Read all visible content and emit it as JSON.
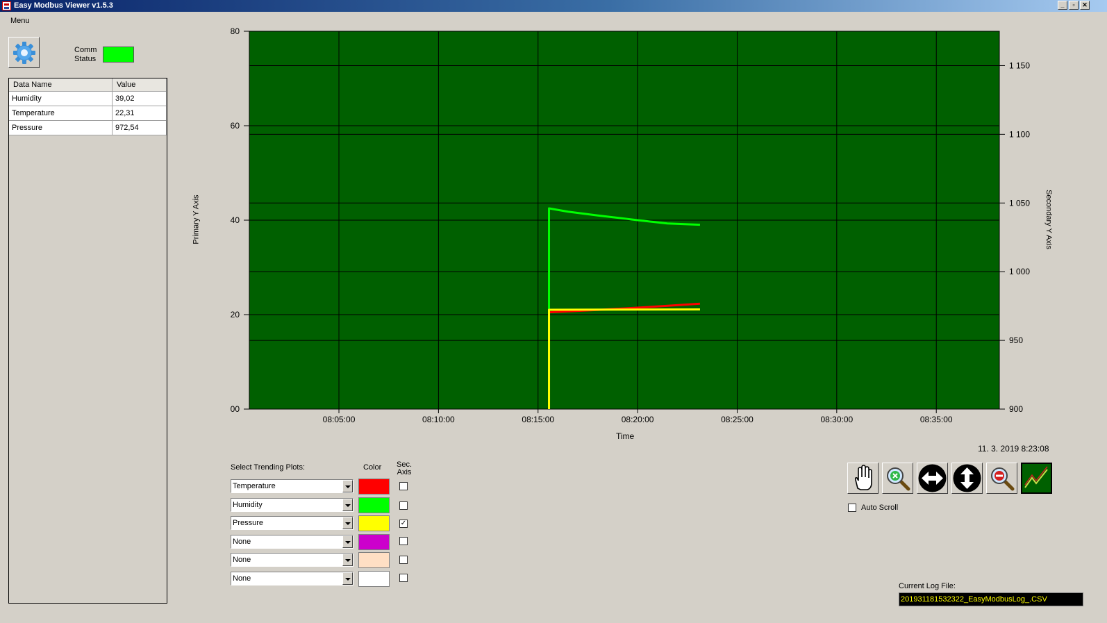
{
  "window": {
    "title": "Easy Modbus Viewer v1.5.3"
  },
  "menu": {
    "label": "Menu"
  },
  "comm": {
    "label_line1": "Comm",
    "label_line2": "Status",
    "led_color": "#00ff00",
    "settings_icon": "gear-icon"
  },
  "grid": {
    "headers": [
      "Data Name",
      "Value"
    ],
    "rows": [
      {
        "name": "Humidity",
        "value": "39,02"
      },
      {
        "name": "Temperature",
        "value": "22,31"
      },
      {
        "name": "Pressure",
        "value": "972,54"
      }
    ]
  },
  "chart_data": {
    "type": "line",
    "background": "#006000",
    "grid": true,
    "xlabel": "Time",
    "ylabel": "Primary Y Axis",
    "y2label": "Secondary Y Axis",
    "x_ticks": [
      "08:05:00",
      "08:10:00",
      "08:15:00",
      "08:20:00",
      "08:25:00",
      "08:30:00",
      "08:35:00"
    ],
    "xlim": [
      "08:00:30",
      "08:38:10"
    ],
    "y_ticks": [
      "00",
      "20",
      "40",
      "60",
      "80"
    ],
    "ylim": [
      0,
      80
    ],
    "y2_ticks": [
      "900",
      "950",
      "1 000",
      "1 050",
      "1 100",
      "1 150"
    ],
    "y2lim": [
      900,
      1175
    ],
    "series": [
      {
        "name": "Temperature",
        "color": "#ff0000",
        "axis": "primary",
        "points": [
          [
            "08:15:33",
            0
          ],
          [
            "08:15:33",
            20.5
          ],
          [
            "08:18:00",
            21.0
          ],
          [
            "08:20:30",
            21.6
          ],
          [
            "08:23:08",
            22.31
          ]
        ]
      },
      {
        "name": "Humidity",
        "color": "#00ff00",
        "axis": "primary",
        "points": [
          [
            "08:15:33",
            0
          ],
          [
            "08:15:33",
            42.5
          ],
          [
            "08:16:30",
            41.8
          ],
          [
            "08:18:00",
            41.0
          ],
          [
            "08:20:00",
            40.0
          ],
          [
            "08:21:30",
            39.3
          ],
          [
            "08:23:08",
            39.02
          ]
        ]
      },
      {
        "name": "Pressure",
        "color": "#ffff00",
        "axis": "secondary",
        "points": [
          [
            "08:15:33",
            900
          ],
          [
            "08:15:33",
            972.3
          ],
          [
            "08:19:00",
            972.4
          ],
          [
            "08:23:08",
            972.54
          ]
        ]
      }
    ]
  },
  "trending": {
    "label": "Select Trending Plots:",
    "color_header": "Color",
    "sec_header_line1": "Sec.",
    "sec_header_line2": "Axis",
    "rows": [
      {
        "selected": "Temperature",
        "color": "#ff0000",
        "sec_axis": false
      },
      {
        "selected": "Humidity",
        "color": "#00ff00",
        "sec_axis": false
      },
      {
        "selected": "Pressure",
        "color": "#ffff00",
        "sec_axis": true
      },
      {
        "selected": "None",
        "color": "#cc00cc",
        "sec_axis": false
      },
      {
        "selected": "None",
        "color": "#ffdfc4",
        "sec_axis": false
      },
      {
        "selected": "None",
        "color": "#ffffff",
        "sec_axis": false
      }
    ]
  },
  "status": {
    "datetime": "11. 3. 2019 8:23:08",
    "auto_scroll_label": "Auto Scroll",
    "auto_scroll_checked": false,
    "log_file_label": "Current Log File:",
    "log_file_value": "201931181532322_EasyModbusLog_.CSV"
  },
  "toolbar": {
    "icons": [
      "pan-hand-icon",
      "zoom-in-icon",
      "horizontal-zoom-icon",
      "vertical-zoom-icon",
      "zoom-reset-icon",
      "trend-chart-icon"
    ]
  }
}
